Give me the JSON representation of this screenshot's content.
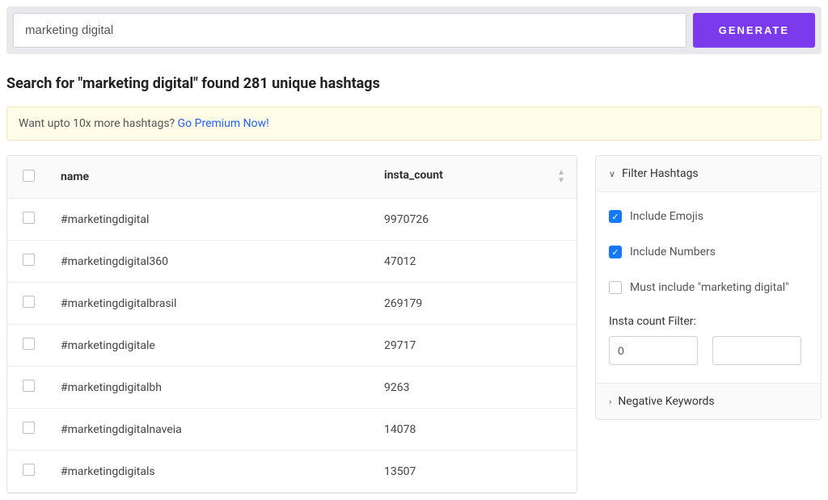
{
  "search": {
    "value": "marketing digital",
    "button": "GENERATE"
  },
  "heading": "Search for \"marketing digital\" found 281 unique hashtags",
  "banner": {
    "text": "Want upto 10x more hashtags? ",
    "link": "Go Premium Now!"
  },
  "table": {
    "headers": {
      "name": "name",
      "count": "insta_count"
    },
    "rows": [
      {
        "name": "#marketingdigital",
        "count": "9970726"
      },
      {
        "name": "#marketingdigital360",
        "count": "47012"
      },
      {
        "name": "#marketingdigitalbrasil",
        "count": "269179"
      },
      {
        "name": "#marketingdigitale",
        "count": "29717"
      },
      {
        "name": "#marketingdigitalbh",
        "count": "9263"
      },
      {
        "name": "#marketingdigitalnaveia",
        "count": "14078"
      },
      {
        "name": "#marketingdigitals",
        "count": "13507"
      }
    ]
  },
  "filters": {
    "title": "Filter Hashtags",
    "emojis": "Include Emojis",
    "numbers": "Include Numbers",
    "mustinclude": "Must include \"marketing digital\"",
    "instalabel": "Insta count Filter:",
    "instamin": "0",
    "instamax": "",
    "negative": "Negative Keywords"
  }
}
